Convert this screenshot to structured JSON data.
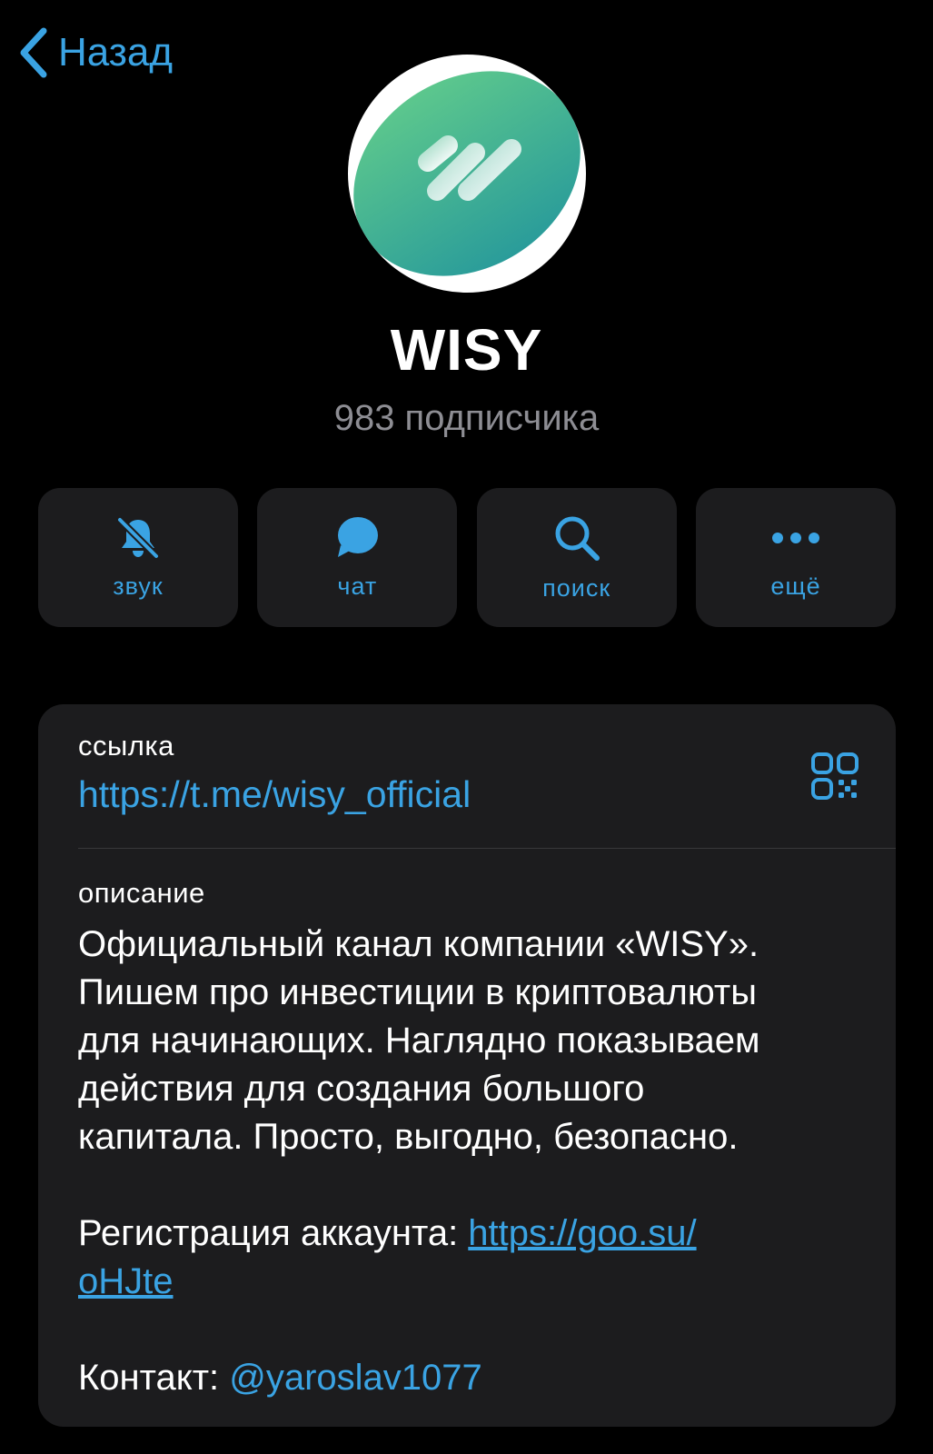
{
  "nav": {
    "back_label": "Назад",
    "back_icon": "chevron-left-icon"
  },
  "colors": {
    "accent": "#3aa3e3",
    "background": "#000000",
    "card": "#1c1c1e",
    "secondary_text": "#8d8d93",
    "avatar_green_top": "#5cc78d",
    "avatar_green_bottom": "#2a9c9a"
  },
  "channel": {
    "title": "WISY",
    "subscribers": "983 подписчика",
    "avatar_icon": "wisy-logo"
  },
  "actions": [
    {
      "label": "звук",
      "icon": "bell-slash-icon"
    },
    {
      "label": "чат",
      "icon": "chat-bubble-icon"
    },
    {
      "label": "поиск",
      "icon": "search-icon"
    },
    {
      "label": "ещё",
      "icon": "more-dots-icon"
    }
  ],
  "info": {
    "link_label": "ссылка",
    "link_url": "https://t.me/wisy_official",
    "qr_icon": "qr-code-icon",
    "description_label": "описание",
    "description_lines": [
      "Официальный канал компании «WISY».",
      "Пишем про инвестиции в криптовалюты",
      "для начинающих. Наглядно показываем",
      "действия для создания большого",
      "капитала. Просто, выгодно, безопасно."
    ],
    "registration_prefix": "Регистрация аккаунта: ",
    "registration_link_line1": "https://goo.su/",
    "registration_link_line2": "oHJte",
    "contact_prefix": "Контакт: ",
    "contact_mention": "@yaroslav1077"
  }
}
